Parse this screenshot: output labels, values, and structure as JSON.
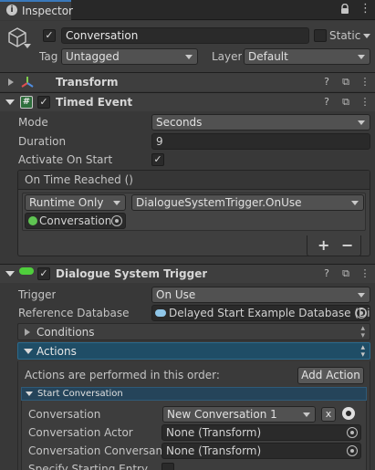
{
  "tab": {
    "title": "Inspector"
  },
  "gameobject": {
    "name": "Conversation",
    "static_label": "Static",
    "tag_label": "Tag",
    "tag_value": "Untagged",
    "layer_label": "Layer",
    "layer_value": "Default"
  },
  "components": {
    "transform": {
      "title": "Transform"
    },
    "timed_event": {
      "title": "Timed Event",
      "mode_label": "Mode",
      "mode_value": "Seconds",
      "duration_label": "Duration",
      "duration_value": "9",
      "activate_label": "Activate On Start",
      "event_header": "On Time Reached ()",
      "runtime_value": "Runtime Only",
      "function_value": "DialogueSystemTrigger.OnUse",
      "object_value": "Conversation",
      "plus": "+",
      "minus": "−"
    },
    "dialogue_trigger": {
      "title": "Dialogue System Trigger",
      "trigger_label": "Trigger",
      "trigger_value": "On Use",
      "refdb_label": "Reference Database",
      "refdb_value": "Delayed Start Example Database (Dia",
      "conditions_label": "Conditions",
      "actions_label": "Actions",
      "actions_desc": "Actions are performed in this order:",
      "add_action": "Add Action",
      "start_conv_label": "Start Conversation",
      "conversation_label": "Conversation",
      "conversation_value": "New Conversation 1",
      "x_label": "x",
      "actor_label": "Conversation Actor",
      "actor_value": "None (Transform)",
      "conversant_label": "Conversation Conversant",
      "conversant_value": "None (Transform)",
      "specify_label": "Specify Starting Entry"
    }
  },
  "colors": {
    "accent": "#3a79bb",
    "actions_bar": "#1f4d66",
    "start_conv_bar": "#25445a"
  }
}
